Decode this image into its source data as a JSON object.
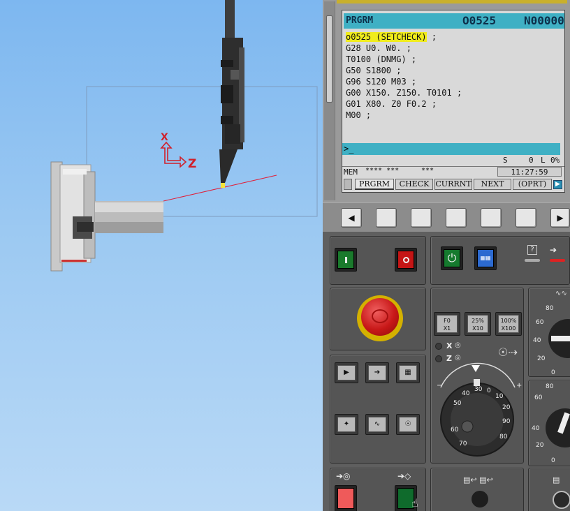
{
  "crt": {
    "mode": "PRGRM",
    "program_no": "O0525",
    "seq_no": "N00000",
    "code_lines": [
      "o0525 (SETCHECK) ;",
      "G28 U0. W0. ;",
      "T0100 (DNMG) ;",
      "G50 S1800 ;",
      "G96 S120 M03 ;",
      "G00 X150. Z150. T0101 ;",
      "G01 X80. Z0 F0.2 ;",
      "M00 ;"
    ],
    "highlight_first": "o0525 (SETCHECK)",
    "highlight_rest": " ;",
    "input_prompt": ">_",
    "spindle_label": "S",
    "spindle_value": "0",
    "load_label": "L",
    "load_value": "0%",
    "mem_label": "MEM",
    "mem_stars": "**** ***",
    "mem_stars2": "***",
    "clock": "11:27:59",
    "softkeys": [
      "PRGRM",
      "CHECK",
      "CURRNT",
      "NEXT",
      "(OPRT)"
    ],
    "softkey_active": "PRGRM"
  },
  "viewport": {
    "axis_x": "X",
    "axis_z": "Z"
  },
  "panel": {
    "help_glyph": "?",
    "feed_override_keys": [
      "F0",
      "25%",
      "100%"
    ],
    "feed_override_sub": [
      "X1",
      "X10",
      "X100"
    ],
    "axis_x_label": "X",
    "axis_z_label": "Z",
    "dial_numbers": [
      "0",
      "10",
      "20",
      "30",
      "40",
      "50",
      "60",
      "70",
      "80",
      "90"
    ],
    "override_scale": [
      "80",
      "60",
      "40",
      "20",
      "0"
    ],
    "override_scale2": [
      "80",
      "60",
      "40",
      "20",
      "0"
    ]
  },
  "colors": {
    "crt_bar": "#3fb0c4",
    "highlight": "#f0ec1c",
    "estop": "#d82020",
    "cycle_start": "#0f6b2c",
    "feed_hold": "#ef5a5a"
  }
}
